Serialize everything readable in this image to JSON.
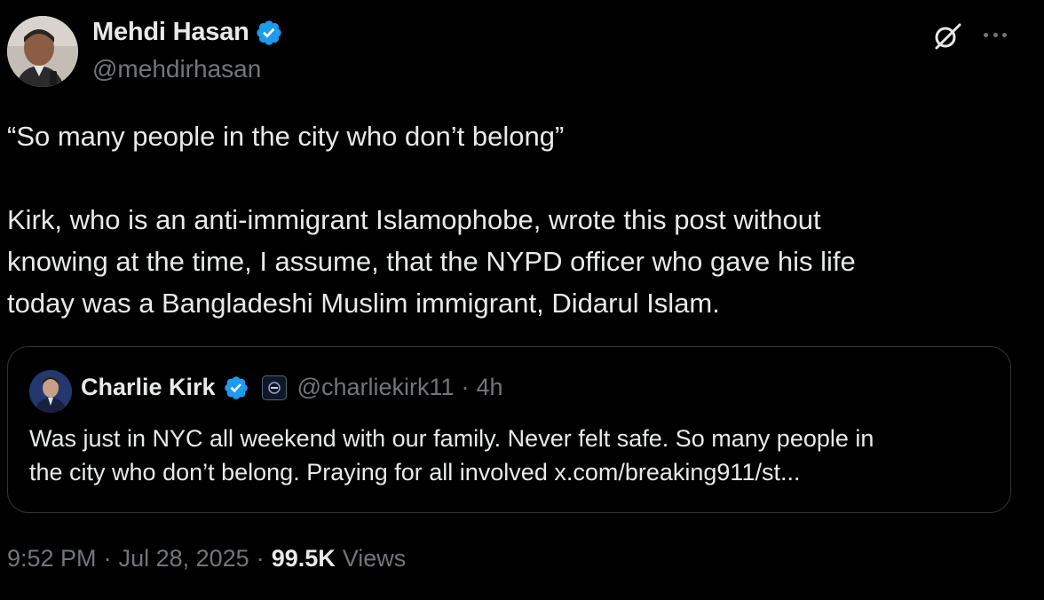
{
  "author": {
    "name": "Mehdi Hasan",
    "handle": "@mehdirhasan",
    "verified": true
  },
  "tweet": {
    "lines": [
      "“So many people in the city who don’t belong”",
      "",
      "Kirk, who is an anti-immigrant Islamophobe, wrote this post without",
      "knowing at the time, I assume, that the NYPD officer who gave his life",
      "today was a Bangladeshi Muslim immigrant, Didarul Islam."
    ]
  },
  "quote": {
    "name": "Charlie Kirk",
    "verified": true,
    "handle": "@charliekirk11",
    "separator": "·",
    "time": "4h",
    "text_line1": "Was just in NYC all weekend with our family. Never felt safe. So many people in",
    "text_line2": "the city who don’t belong. Praying for all involved x.com/breaking911/st..."
  },
  "meta": {
    "time": "9:52 PM",
    "sep1": "·",
    "date": "Jul 28, 2025",
    "sep2": "·",
    "views_count": "99.5K",
    "views_label": "Views"
  },
  "icons": {
    "verified": "verified-badge-icon",
    "grok": "grok-icon",
    "more": "more-options-icon"
  },
  "colors": {
    "background": "#000000",
    "text": "#e7e9ea",
    "secondary": "#71767b",
    "verified": "#1d9bf0",
    "border": "#2f3336"
  }
}
